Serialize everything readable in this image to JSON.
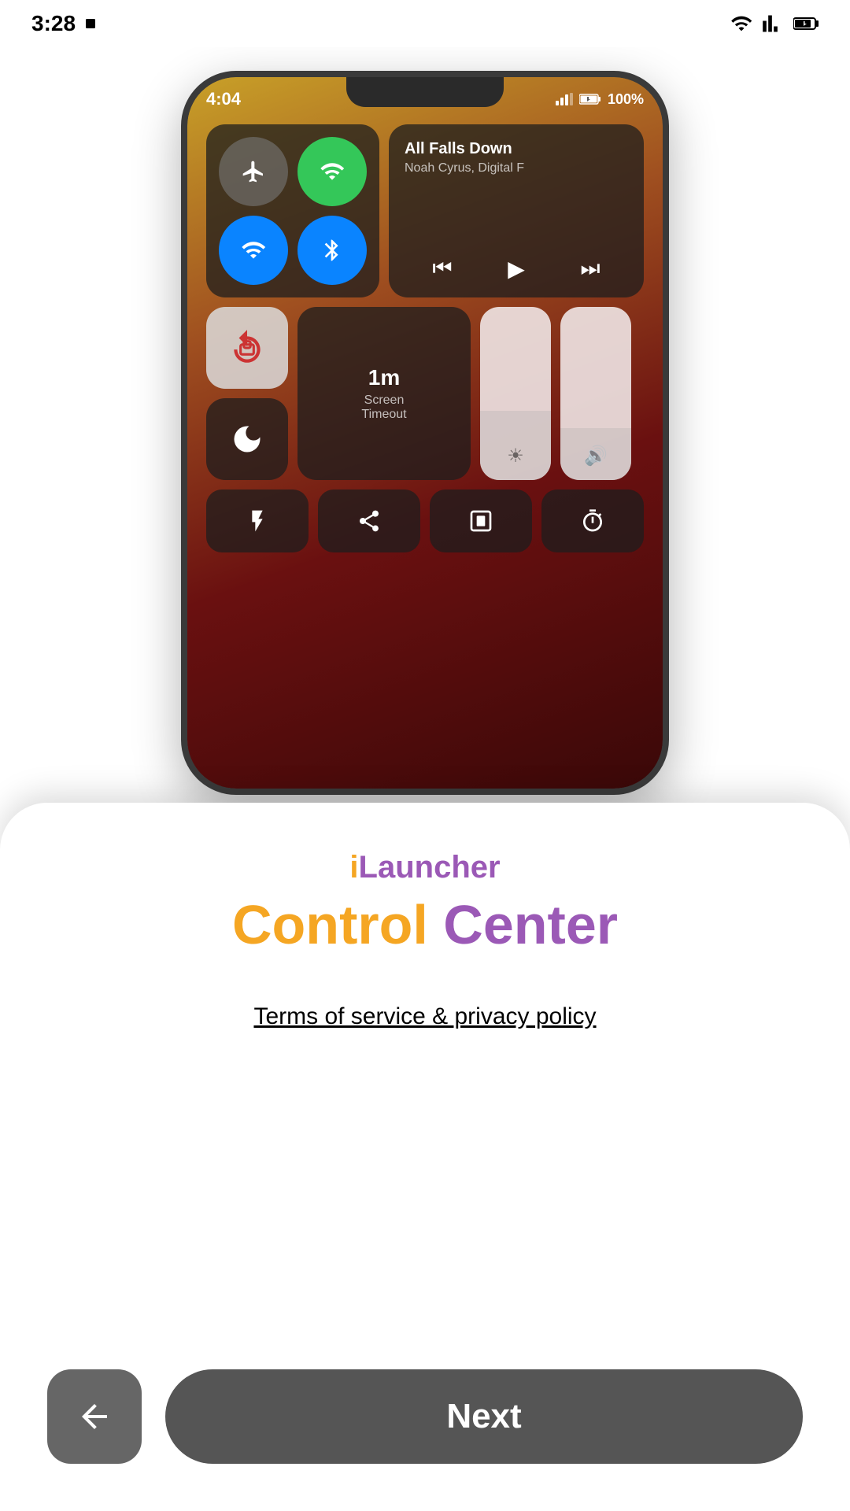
{
  "statusBar": {
    "time": "3:28",
    "icons": [
      "wifi",
      "signal",
      "battery"
    ]
  },
  "phoneScreen": {
    "time": "4:04",
    "battery": "100%",
    "music": {
      "title": "All Falls Down",
      "artist": "Noah Cyrus, Digital F"
    },
    "screenTimeout": {
      "value": "1m",
      "label": "Screen\nTimeout"
    }
  },
  "card": {
    "appName": {
      "prefix": "i",
      "suffix": "Launcher"
    },
    "subtitle": {
      "part1": "Control",
      "part2": " Center"
    },
    "termsLabel": "Terms of service & privacy policy",
    "backButton": "←",
    "nextButton": "Next"
  }
}
